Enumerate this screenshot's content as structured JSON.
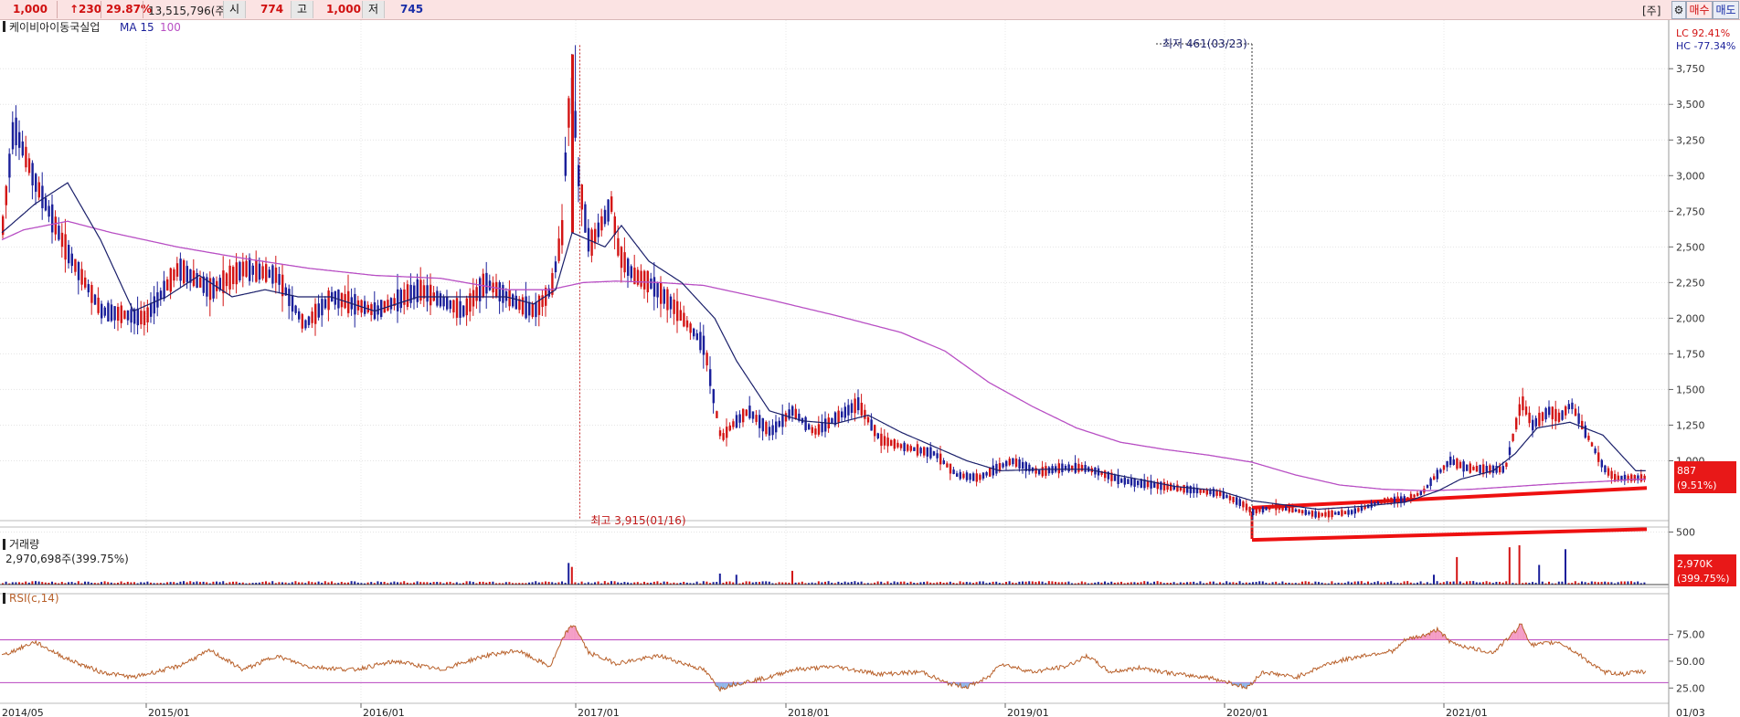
{
  "topbar": {
    "price": "1,000",
    "change": "↑230",
    "change_pct": "29.87%",
    "volume": "13,515,796(주)",
    "open_label": "시",
    "open_value": "774",
    "high_label": "고",
    "high_value": "1,000",
    "low_label": "저",
    "low_value": "745",
    "stock_badge": "[주]",
    "settings_icon": "gear-icon",
    "buy_label": "매수",
    "sell_label": "매도"
  },
  "colors": {
    "up": "#d31414",
    "down": "#1a1f9a",
    "ma15": "#1a1f6a",
    "ma100": "#b84fc4",
    "rsi": "#b8602a",
    "rsi_line": "#b845c0",
    "trend": "#ee1010",
    "highlight": "#e81818"
  },
  "chart_data": [
    {
      "type": "candlestick",
      "title": "케이비아이동국실업",
      "indicators": [
        "MA 15",
        "100"
      ],
      "ylim": [
        420,
        3950
      ],
      "yticks": [
        3750,
        3500,
        3250,
        3000,
        2750,
        2500,
        2250,
        2000,
        1750,
        1500,
        1250,
        1000,
        500
      ],
      "ytick_labels": [
        "3,750",
        "3,500",
        "3,250",
        "3,000",
        "2,750",
        "2,500",
        "2,250",
        "2,000",
        "1,750",
        "1,500",
        "1,250",
        "1,000",
        "500"
      ],
      "x_labels": [
        "2014/05",
        "2015/01",
        "2016/01",
        "2017/01",
        "2018/01",
        "2019/01",
        "2020/01",
        "2021/01",
        "01/03"
      ],
      "anchors_price": [
        [
          0,
          2650
        ],
        [
          10,
          3350
        ],
        [
          30,
          2950
        ],
        [
          60,
          2450
        ],
        [
          90,
          2050
        ],
        [
          130,
          2000
        ],
        [
          160,
          2350
        ],
        [
          190,
          2200
        ],
        [
          220,
          2350
        ],
        [
          250,
          2300
        ],
        [
          275,
          1950
        ],
        [
          300,
          2150
        ],
        [
          340,
          2050
        ],
        [
          380,
          2200
        ],
        [
          420,
          2050
        ],
        [
          440,
          2250
        ],
        [
          470,
          2100
        ],
        [
          485,
          2050
        ],
        [
          500,
          2200
        ],
        [
          510,
          2600
        ],
        [
          515,
          3400
        ],
        [
          520,
          3600
        ],
        [
          525,
          3000
        ],
        [
          535,
          2500
        ],
        [
          545,
          2650
        ],
        [
          555,
          2800
        ],
        [
          562,
          2450
        ],
        [
          575,
          2300
        ],
        [
          590,
          2250
        ],
        [
          610,
          2100
        ],
        [
          640,
          1800
        ],
        [
          655,
          1150
        ],
        [
          665,
          1250
        ],
        [
          680,
          1350
        ],
        [
          700,
          1200
        ],
        [
          720,
          1350
        ],
        [
          740,
          1200
        ],
        [
          760,
          1300
        ],
        [
          780,
          1400
        ],
        [
          800,
          1150
        ],
        [
          820,
          1100
        ],
        [
          850,
          1050
        ],
        [
          870,
          900
        ],
        [
          890,
          880
        ],
        [
          905,
          940
        ],
        [
          920,
          1000
        ],
        [
          945,
          920
        ],
        [
          965,
          950
        ],
        [
          985,
          950
        ],
        [
          1000,
          920
        ],
        [
          1020,
          860
        ],
        [
          1050,
          830
        ],
        [
          1080,
          800
        ],
        [
          1110,
          770
        ],
        [
          1130,
          700
        ],
        [
          1140,
          640
        ],
        [
          1160,
          680
        ],
        [
          1180,
          650
        ],
        [
          1200,
          620
        ],
        [
          1230,
          640
        ],
        [
          1260,
          720
        ],
        [
          1280,
          730
        ],
        [
          1295,
          780
        ],
        [
          1305,
          880
        ],
        [
          1320,
          1000
        ],
        [
          1335,
          950
        ],
        [
          1350,
          940
        ],
        [
          1370,
          940
        ],
        [
          1385,
          1420
        ],
        [
          1395,
          1250
        ],
        [
          1410,
          1350
        ],
        [
          1420,
          1300
        ],
        [
          1430,
          1400
        ],
        [
          1440,
          1250
        ],
        [
          1460,
          950
        ],
        [
          1470,
          880
        ],
        [
          1490,
          880
        ]
      ],
      "anchors_ma15": [
        [
          0,
          2600
        ],
        [
          30,
          2800
        ],
        [
          60,
          2950
        ],
        [
          90,
          2550
        ],
        [
          120,
          2050
        ],
        [
          150,
          2150
        ],
        [
          180,
          2300
        ],
        [
          210,
          2150
        ],
        [
          240,
          2200
        ],
        [
          270,
          2150
        ],
        [
          300,
          2150
        ],
        [
          340,
          2050
        ],
        [
          380,
          2150
        ],
        [
          420,
          2150
        ],
        [
          460,
          2150
        ],
        [
          485,
          2100
        ],
        [
          505,
          2200
        ],
        [
          520,
          2600
        ],
        [
          535,
          2550
        ],
        [
          550,
          2500
        ],
        [
          565,
          2650
        ],
        [
          590,
          2400
        ],
        [
          620,
          2250
        ],
        [
          650,
          2000
        ],
        [
          670,
          1700
        ],
        [
          700,
          1350
        ],
        [
          730,
          1280
        ],
        [
          760,
          1260
        ],
        [
          790,
          1320
        ],
        [
          820,
          1200
        ],
        [
          850,
          1100
        ],
        [
          880,
          1000
        ],
        [
          910,
          930
        ],
        [
          950,
          940
        ],
        [
          990,
          940
        ],
        [
          1030,
          880
        ],
        [
          1070,
          820
        ],
        [
          1110,
          790
        ],
        [
          1140,
          720
        ],
        [
          1170,
          690
        ],
        [
          1200,
          660
        ],
        [
          1240,
          680
        ],
        [
          1280,
          710
        ],
        [
          1310,
          790
        ],
        [
          1330,
          870
        ],
        [
          1360,
          930
        ],
        [
          1380,
          1050
        ],
        [
          1400,
          1230
        ],
        [
          1430,
          1270
        ],
        [
          1460,
          1180
        ],
        [
          1490,
          930
        ]
      ],
      "anchors_ma100": [
        [
          0,
          2550
        ],
        [
          20,
          2620
        ],
        [
          60,
          2680
        ],
        [
          100,
          2600
        ],
        [
          160,
          2500
        ],
        [
          220,
          2420
        ],
        [
          280,
          2350
        ],
        [
          340,
          2300
        ],
        [
          400,
          2280
        ],
        [
          460,
          2200
        ],
        [
          500,
          2200
        ],
        [
          530,
          2250
        ],
        [
          560,
          2260
        ],
        [
          600,
          2250
        ],
        [
          640,
          2230
        ],
        [
          700,
          2130
        ],
        [
          760,
          2020
        ],
        [
          820,
          1900
        ],
        [
          860,
          1770
        ],
        [
          900,
          1550
        ],
        [
          940,
          1380
        ],
        [
          980,
          1230
        ],
        [
          1020,
          1130
        ],
        [
          1060,
          1080
        ],
        [
          1100,
          1040
        ],
        [
          1140,
          990
        ],
        [
          1180,
          900
        ],
        [
          1220,
          830
        ],
        [
          1260,
          800
        ],
        [
          1300,
          790
        ],
        [
          1340,
          800
        ],
        [
          1380,
          820
        ],
        [
          1420,
          840
        ],
        [
          1460,
          855
        ],
        [
          1490,
          870
        ]
      ],
      "annotations": [
        {
          "text": "최저 461(03/23)",
          "x_index": 1140
        },
        {
          "text": "최고 3,915(01/16)",
          "x_index": 527
        }
      ],
      "right_markers": {
        "lc": "LC 92.41%",
        "hc": "HC -77.34%",
        "current_price": "887",
        "current_pct": "(9.51%)"
      },
      "trend_lines": [
        [
          [
            1140,
            671
          ],
          [
            1500,
            809
          ]
        ],
        [
          [
            1140,
            445
          ],
          [
            1500,
            520
          ]
        ]
      ]
    },
    {
      "type": "bar",
      "title": "거래량",
      "value_label": "2,970,698주(399.75%)",
      "right_marker": "2,970K",
      "right_marker_pct": "(399.75%)",
      "spikes": [
        [
          515,
          0.55
        ],
        [
          520,
          0.45
        ],
        [
          655,
          0.28
        ],
        [
          670,
          0.25
        ],
        [
          720,
          0.35
        ],
        [
          1305,
          0.25
        ],
        [
          1325,
          0.7
        ],
        [
          1375,
          0.95
        ],
        [
          1382,
          1.0
        ],
        [
          1400,
          0.5
        ],
        [
          1425,
          0.9
        ]
      ]
    },
    {
      "type": "line",
      "title": "RSI(c,14)",
      "ylim": [
        15,
        90
      ],
      "levels": [
        70,
        30
      ],
      "yticks": [
        75,
        50,
        25
      ],
      "ytick_labels": [
        "75.00",
        "50.00",
        "25.00"
      ],
      "anchors_rsi": [
        [
          0,
          55
        ],
        [
          30,
          68
        ],
        [
          60,
          52
        ],
        [
          90,
          40
        ],
        [
          120,
          35
        ],
        [
          160,
          45
        ],
        [
          190,
          60
        ],
        [
          220,
          42
        ],
        [
          250,
          55
        ],
        [
          280,
          45
        ],
        [
          320,
          42
        ],
        [
          360,
          50
        ],
        [
          400,
          42
        ],
        [
          440,
          55
        ],
        [
          470,
          60
        ],
        [
          500,
          45
        ],
        [
          515,
          78
        ],
        [
          522,
          84
        ],
        [
          535,
          58
        ],
        [
          560,
          48
        ],
        [
          600,
          55
        ],
        [
          640,
          42
        ],
        [
          655,
          24
        ],
        [
          665,
          28
        ],
        [
          700,
          35
        ],
        [
          720,
          42
        ],
        [
          760,
          45
        ],
        [
          800,
          38
        ],
        [
          840,
          40
        ],
        [
          860,
          30
        ],
        [
          880,
          26
        ],
        [
          900,
          35
        ],
        [
          910,
          48
        ],
        [
          940,
          40
        ],
        [
          970,
          45
        ],
        [
          990,
          55
        ],
        [
          1010,
          40
        ],
        [
          1040,
          44
        ],
        [
          1070,
          38
        ],
        [
          1100,
          35
        ],
        [
          1120,
          30
        ],
        [
          1135,
          25
        ],
        [
          1150,
          40
        ],
        [
          1180,
          35
        ],
        [
          1210,
          48
        ],
        [
          1240,
          55
        ],
        [
          1270,
          60
        ],
        [
          1280,
          70
        ],
        [
          1300,
          75
        ],
        [
          1310,
          80
        ],
        [
          1320,
          68
        ],
        [
          1340,
          62
        ],
        [
          1360,
          58
        ],
        [
          1380,
          78
        ],
        [
          1385,
          85
        ],
        [
          1395,
          65
        ],
        [
          1420,
          68
        ],
        [
          1440,
          55
        ],
        [
          1460,
          40
        ],
        [
          1480,
          38
        ],
        [
          1490,
          40
        ]
      ]
    }
  ]
}
